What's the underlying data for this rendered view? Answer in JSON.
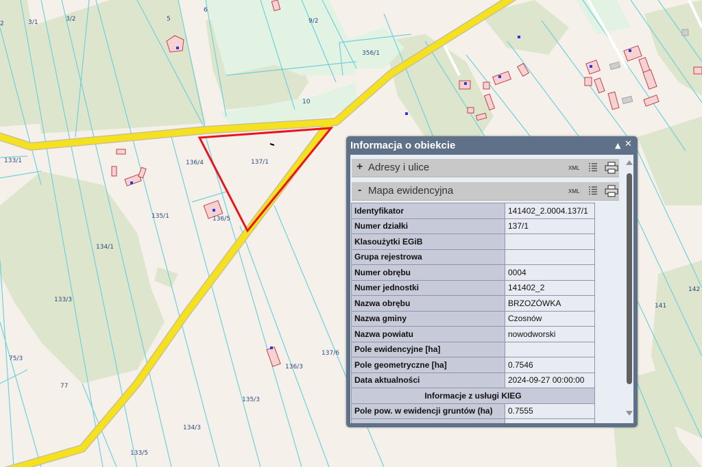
{
  "map": {
    "parcel_labels": [
      {
        "text": "2"
      },
      {
        "text": "3/1"
      },
      {
        "text": "3/2"
      },
      {
        "text": "5"
      },
      {
        "text": "6"
      },
      {
        "text": "9/2"
      },
      {
        "text": "356/1"
      },
      {
        "text": "10"
      },
      {
        "text": "133/1"
      },
      {
        "text": "136/4"
      },
      {
        "text": "137/1"
      },
      {
        "text": "135/1"
      },
      {
        "text": "136/5"
      },
      {
        "text": "134/1"
      },
      {
        "text": "133/3"
      },
      {
        "text": "75/3"
      },
      {
        "text": "77"
      },
      {
        "text": "135/3"
      },
      {
        "text": "134/3"
      },
      {
        "text": "133/5"
      },
      {
        "text": "136/3"
      },
      {
        "text": "137/6"
      },
      {
        "text": "141"
      },
      {
        "text": "142"
      }
    ],
    "colors": {
      "background": "#f5f1ea",
      "forest": "#dde6cc",
      "meadow": "#e3f3e3",
      "road": "#f6e11e",
      "road_outline": "#c9c094",
      "parcel_line": "#6fd0dc",
      "selection": "#e8141e",
      "building_fill": "#f6d2d2",
      "building_stroke": "#c0404a"
    }
  },
  "panel": {
    "title": "Informacja o obiekcie",
    "collapse_icon": "triangle-up-icon",
    "close_icon": "close-icon",
    "sections": [
      {
        "sign": "+",
        "title": "Adresy i ulice",
        "xml": "XML"
      },
      {
        "sign": "-",
        "title": "Mapa ewidencyjna",
        "xml": "XML"
      }
    ],
    "rows": [
      {
        "key": "Identyfikator",
        "value": "141402_2.0004.137/1"
      },
      {
        "key": "Numer działki",
        "value": "137/1"
      },
      {
        "key": "Klasoużytki EGiB",
        "value": ""
      },
      {
        "key": "Grupa rejestrowa",
        "value": ""
      },
      {
        "key": "Numer obrębu",
        "value": "0004"
      },
      {
        "key": "Numer jednostki",
        "value": "141402_2"
      },
      {
        "key": "Nazwa obrębu",
        "value": "BRZOZÓWKA"
      },
      {
        "key": "Nazwa gminy",
        "value": "Czosnów"
      },
      {
        "key": "Nazwa powiatu",
        "value": "nowodworski"
      },
      {
        "key": "Pole ewidencyjne [ha]",
        "value": ""
      },
      {
        "key": "Pole geometryczne [ha]",
        "value": "0.7546"
      },
      {
        "key": "Data aktualności",
        "value": "2024-09-27 00:00:00"
      }
    ],
    "kieg_header": "Informacje z usługi KIEG",
    "kieg_rows": [
      {
        "key": "Pole pow. w ewidencji gruntów (ha)",
        "value": "0.7555"
      }
    ]
  }
}
